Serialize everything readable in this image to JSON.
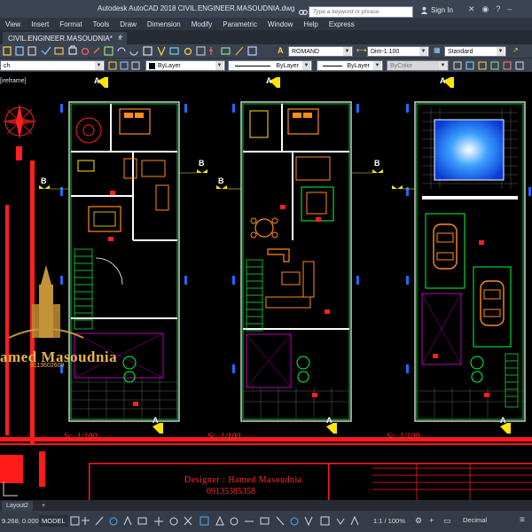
{
  "window": {
    "title": "Autodesk AutoCAD 2018    CIVIL.ENGINEER.MASOUDNIA.dwg",
    "search_placeholder": "Type a keyword or phrase",
    "sign_in": "Sign In"
  },
  "menu": [
    "View",
    "Insert",
    "Format",
    "Tools",
    "Draw",
    "Dimension",
    "Modify",
    "Parametric",
    "Window",
    "Help",
    "Express"
  ],
  "doc_tab": {
    "label": "CIVIL.ENGINEER.MASOUDNIA*",
    "close": "×",
    "add": "+"
  },
  "toolbar": {
    "text_style": "ROMAND",
    "dim_style": "Dim-1.100",
    "table_style": "Standard",
    "layer_partial": "ch",
    "color": "ByLayer",
    "linetype": "ByLayer",
    "lineweight": "ByLayer",
    "plot_style": "ByColor"
  },
  "canvas": {
    "viewport_label": "[ireframe]",
    "watermark_name": "amed Masoudnia",
    "watermark_phone": "9113602609",
    "scales": [
      "Sc. 1/100",
      "Sc. 1/100",
      "Sc. 1/100"
    ],
    "designer": "Designer : Hamed Masoudnia",
    "designer_phone": "09135385358",
    "section_marks": [
      "A",
      "A",
      "A",
      "B",
      "B",
      "B",
      "B",
      "A",
      "A",
      "A"
    ]
  },
  "layout_tabs": [
    "Layout2",
    "+"
  ],
  "status": {
    "coords": "9.268, 0.000",
    "model": "MODEL",
    "scale": "1:1 / 100%",
    "units": "Decimal"
  },
  "colors": {
    "accent_red": "#ff1a1a",
    "cad_green": "#00ff3c",
    "cad_yellow": "#ffe600",
    "cad_orange": "#ff8c1a",
    "cad_magenta": "#b400b4",
    "cad_blue": "#1e6bff"
  }
}
